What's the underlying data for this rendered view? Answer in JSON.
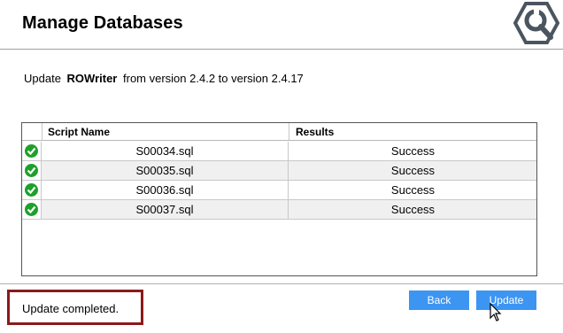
{
  "header": {
    "title": "Manage Databases",
    "logo_icon": "wrench-gear-icon"
  },
  "update_info": {
    "prefix": "Update",
    "app_name": "ROWriter",
    "suffix": "from version 2.4.2 to version 2.4.17"
  },
  "grid": {
    "columns": [
      "Script Name",
      "Results"
    ],
    "rows": [
      {
        "script": "S00034.sql",
        "result": "Success",
        "status_icon": "check-circle-icon"
      },
      {
        "script": "S00035.sql",
        "result": "Success",
        "status_icon": "check-circle-icon"
      },
      {
        "script": "S00036.sql",
        "result": "Success",
        "status_icon": "check-circle-icon"
      },
      {
        "script": "S00037.sql",
        "result": "Success",
        "status_icon": "check-circle-icon"
      }
    ]
  },
  "status": {
    "text": "Update completed."
  },
  "buttons": {
    "back_label": "Back",
    "update_label": "Update"
  },
  "colors": {
    "button_bg": "#3d95f2",
    "status_border": "#8b1a1a",
    "success_green": "#1da12a"
  }
}
